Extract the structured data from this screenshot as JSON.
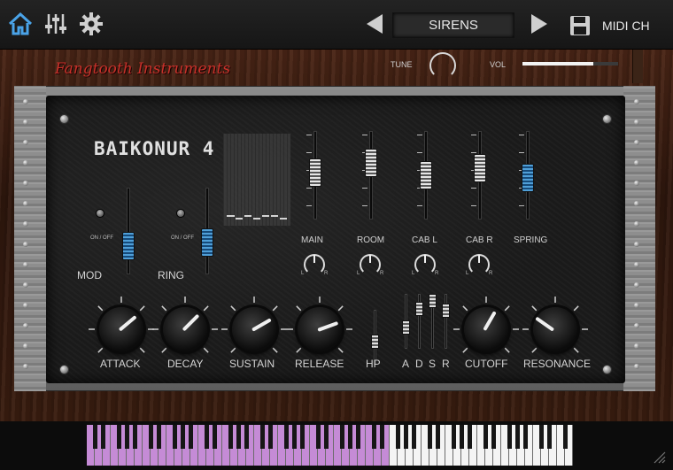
{
  "topbar": {
    "home_icon": "home-icon",
    "mixer_icon": "sliders-icon",
    "settings_icon": "gear-icon",
    "preset_name": "SIRENS",
    "save_icon": "floppy-disk-icon",
    "midi_label": "MIDI CH"
  },
  "header": {
    "brand": "Fangtooth Instruments",
    "tune_label": "TUNE",
    "vol_label": "VOL",
    "vol_level": 0.74
  },
  "panel": {
    "title": "BAIKONUR 4",
    "mod_label": "MOD",
    "ring_label": "RING",
    "onoff_label": "ON / OFF",
    "channels": [
      {
        "label": "MAIN",
        "level": 0.55
      },
      {
        "label": "ROOM",
        "level": 0.7
      },
      {
        "label": "CAB L",
        "level": 0.5
      },
      {
        "label": "CAB R",
        "level": 0.62
      },
      {
        "label": "SPRING",
        "level": 0.45
      }
    ],
    "pan_left": "L",
    "pan_right": "R",
    "knobs": [
      {
        "label": "ATTACK",
        "angle": -40
      },
      {
        "label": "DECAY",
        "angle": -45
      },
      {
        "label": "SUSTAIN",
        "angle": -30
      },
      {
        "label": "RELEASE",
        "angle": -20
      },
      {
        "label": "CUTOFF",
        "angle": -60
      },
      {
        "label": "RESONANCE",
        "angle": 215
      }
    ],
    "hp_label": "HP",
    "adsr_labels": [
      "A",
      "D",
      "S",
      "R"
    ]
  },
  "colors": {
    "accent_blue": "#2f78b8",
    "brand_red": "#c8312a",
    "key_highlight": "#c58bd6"
  }
}
